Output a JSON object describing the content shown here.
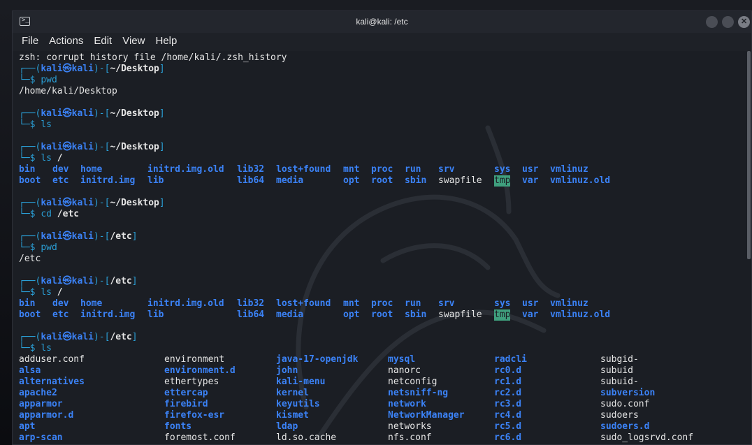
{
  "window": {
    "title": "kali@kali: /etc"
  },
  "menu": [
    "File",
    "Actions",
    "Edit",
    "View",
    "Help"
  ],
  "terminal": {
    "history_error": "zsh: corrupt history file /home/kali/.zsh_history",
    "blocks": [
      {
        "user": "kali",
        "host": "kali",
        "cwd": "~/Desktop",
        "cmd": "pwd",
        "arg": "",
        "output": [
          "/home/kali/Desktop"
        ]
      },
      {
        "user": "kali",
        "host": "kali",
        "cwd": "~/Desktop",
        "cmd": "ls",
        "arg": "",
        "output": []
      },
      {
        "user": "kali",
        "host": "kali",
        "cwd": "~/Desktop",
        "cmd": "ls",
        "arg": "/",
        "listing": "root_ls"
      },
      {
        "user": "kali",
        "host": "kali",
        "cwd": "~/Desktop",
        "cmd": "cd",
        "arg": "/etc",
        "output": []
      },
      {
        "user": "kali",
        "host": "kali",
        "cwd": "/etc",
        "cmd": "pwd",
        "arg": "",
        "output": [
          "/etc"
        ]
      },
      {
        "user": "kali",
        "host": "kali",
        "cwd": "/etc",
        "cmd": "ls",
        "arg": "/",
        "listing": "root_ls"
      },
      {
        "user": "kali",
        "host": "kali",
        "cwd": "/etc",
        "cmd": "ls",
        "arg": "",
        "listing": "etc_ls"
      }
    ],
    "root_ls": [
      [
        {
          "name": "bin",
          "type": "dir"
        },
        {
          "name": "dev",
          "type": "dir"
        },
        {
          "name": "home",
          "type": "dir"
        },
        {
          "name": "initrd.img.old",
          "type": "dir"
        },
        {
          "name": "lib32",
          "type": "dir"
        },
        {
          "name": "lost+found",
          "type": "dir"
        },
        {
          "name": "mnt",
          "type": "dir"
        },
        {
          "name": "proc",
          "type": "dir"
        },
        {
          "name": "run",
          "type": "dir"
        },
        {
          "name": "srv",
          "type": "dir"
        },
        {
          "name": "sys",
          "type": "dir"
        },
        {
          "name": "usr",
          "type": "dir"
        },
        {
          "name": "vmlinuz",
          "type": "dir"
        }
      ],
      [
        {
          "name": "boot",
          "type": "dir"
        },
        {
          "name": "etc",
          "type": "dir"
        },
        {
          "name": "initrd.img",
          "type": "dir"
        },
        {
          "name": "lib",
          "type": "dir"
        },
        {
          "name": "lib64",
          "type": "dir"
        },
        {
          "name": "media",
          "type": "dir"
        },
        {
          "name": "opt",
          "type": "dir"
        },
        {
          "name": "root",
          "type": "dir"
        },
        {
          "name": "sbin",
          "type": "dir"
        },
        {
          "name": "swapfile",
          "type": "file"
        },
        {
          "name": "tmp",
          "type": "tmp"
        },
        {
          "name": "var",
          "type": "dir"
        },
        {
          "name": "vmlinuz.old",
          "type": "dir"
        }
      ]
    ],
    "etc_ls": [
      [
        {
          "name": "adduser.conf",
          "type": "file"
        },
        {
          "name": "environment",
          "type": "file"
        },
        {
          "name": "java-17-openjdk",
          "type": "dir"
        },
        {
          "name": "mysql",
          "type": "dir"
        },
        {
          "name": "radcli",
          "type": "dir"
        },
        {
          "name": "subgid-",
          "type": "file"
        }
      ],
      [
        {
          "name": "alsa",
          "type": "dir"
        },
        {
          "name": "environment.d",
          "type": "dir"
        },
        {
          "name": "john",
          "type": "dir"
        },
        {
          "name": "nanorc",
          "type": "file"
        },
        {
          "name": "rc0.d",
          "type": "dir"
        },
        {
          "name": "subuid",
          "type": "file"
        }
      ],
      [
        {
          "name": "alternatives",
          "type": "dir"
        },
        {
          "name": "ethertypes",
          "type": "file"
        },
        {
          "name": "kali-menu",
          "type": "dir"
        },
        {
          "name": "netconfig",
          "type": "file"
        },
        {
          "name": "rc1.d",
          "type": "dir"
        },
        {
          "name": "subuid-",
          "type": "file"
        }
      ],
      [
        {
          "name": "apache2",
          "type": "dir"
        },
        {
          "name": "ettercap",
          "type": "dir"
        },
        {
          "name": "kernel",
          "type": "dir"
        },
        {
          "name": "netsniff-ng",
          "type": "dir"
        },
        {
          "name": "rc2.d",
          "type": "dir"
        },
        {
          "name": "subversion",
          "type": "dir"
        }
      ],
      [
        {
          "name": "apparmor",
          "type": "dir"
        },
        {
          "name": "firebird",
          "type": "dir"
        },
        {
          "name": "keyutils",
          "type": "dir"
        },
        {
          "name": "network",
          "type": "dir"
        },
        {
          "name": "rc3.d",
          "type": "dir"
        },
        {
          "name": "sudo.conf",
          "type": "file"
        }
      ],
      [
        {
          "name": "apparmor.d",
          "type": "dir"
        },
        {
          "name": "firefox-esr",
          "type": "dir"
        },
        {
          "name": "kismet",
          "type": "dir"
        },
        {
          "name": "NetworkManager",
          "type": "dir"
        },
        {
          "name": "rc4.d",
          "type": "dir"
        },
        {
          "name": "sudoers",
          "type": "file"
        }
      ],
      [
        {
          "name": "apt",
          "type": "dir"
        },
        {
          "name": "fonts",
          "type": "dir"
        },
        {
          "name": "ldap",
          "type": "dir"
        },
        {
          "name": "networks",
          "type": "file"
        },
        {
          "name": "rc5.d",
          "type": "dir"
        },
        {
          "name": "sudoers.d",
          "type": "dir"
        }
      ],
      [
        {
          "name": "arp-scan",
          "type": "dir"
        },
        {
          "name": "foremost.conf",
          "type": "file"
        },
        {
          "name": "ld.so.cache",
          "type": "file"
        },
        {
          "name": "nfs.conf",
          "type": "file"
        },
        {
          "name": "rc6.d",
          "type": "dir"
        },
        {
          "name": "sudo_logsrvd.conf",
          "type": "file"
        }
      ]
    ]
  }
}
